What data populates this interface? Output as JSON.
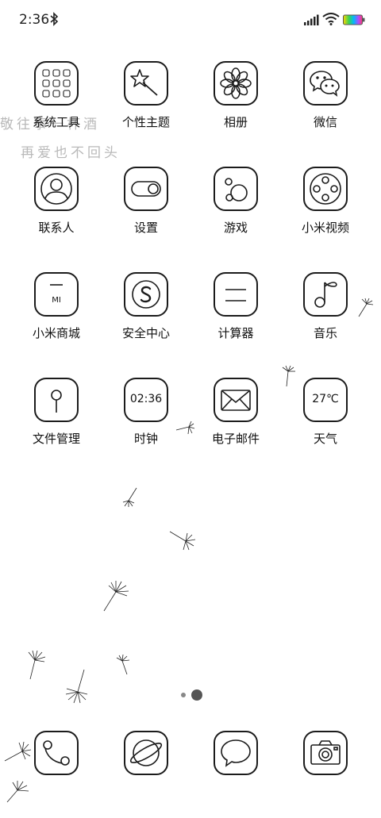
{
  "status": {
    "time": "2:36"
  },
  "overlay": {
    "line1": "敬往事一杯酒",
    "line2": "再爱也不回头"
  },
  "apps": [
    {
      "label": "系统工具",
      "icon": "tools-folder-icon"
    },
    {
      "label": "个性主题",
      "icon": "magic-wand-icon"
    },
    {
      "label": "相册",
      "icon": "flower-gallery-icon"
    },
    {
      "label": "微信",
      "icon": "wechat-icon"
    },
    {
      "label": "联系人",
      "icon": "contacts-icon"
    },
    {
      "label": "设置",
      "icon": "toggle-settings-icon"
    },
    {
      "label": "游戏",
      "icon": "game-icon"
    },
    {
      "label": "小米视频",
      "icon": "video-reel-icon"
    },
    {
      "label": "小米商城",
      "icon": "mi-store-icon",
      "icon_text": "MI"
    },
    {
      "label": "安全中心",
      "icon": "security-icon"
    },
    {
      "label": "计算器",
      "icon": "calculator-icon"
    },
    {
      "label": "音乐",
      "icon": "music-note-icon"
    },
    {
      "label": "文件管理",
      "icon": "file-manager-icon"
    },
    {
      "label": "时钟",
      "icon": "clock-icon",
      "icon_text": "02:36"
    },
    {
      "label": "电子邮件",
      "icon": "email-icon"
    },
    {
      "label": "天气",
      "icon": "weather-icon",
      "icon_text": "27℃"
    }
  ],
  "dock": [
    {
      "icon": "phone-icon"
    },
    {
      "icon": "browser-icon"
    },
    {
      "icon": "messages-icon"
    },
    {
      "icon": "camera-icon"
    }
  ],
  "pager": {
    "pages": 2,
    "current": 2
  },
  "colors": {
    "line": "#1b1b1b",
    "background": "#ffffff",
    "overlay_text": "#b9b9b9"
  }
}
